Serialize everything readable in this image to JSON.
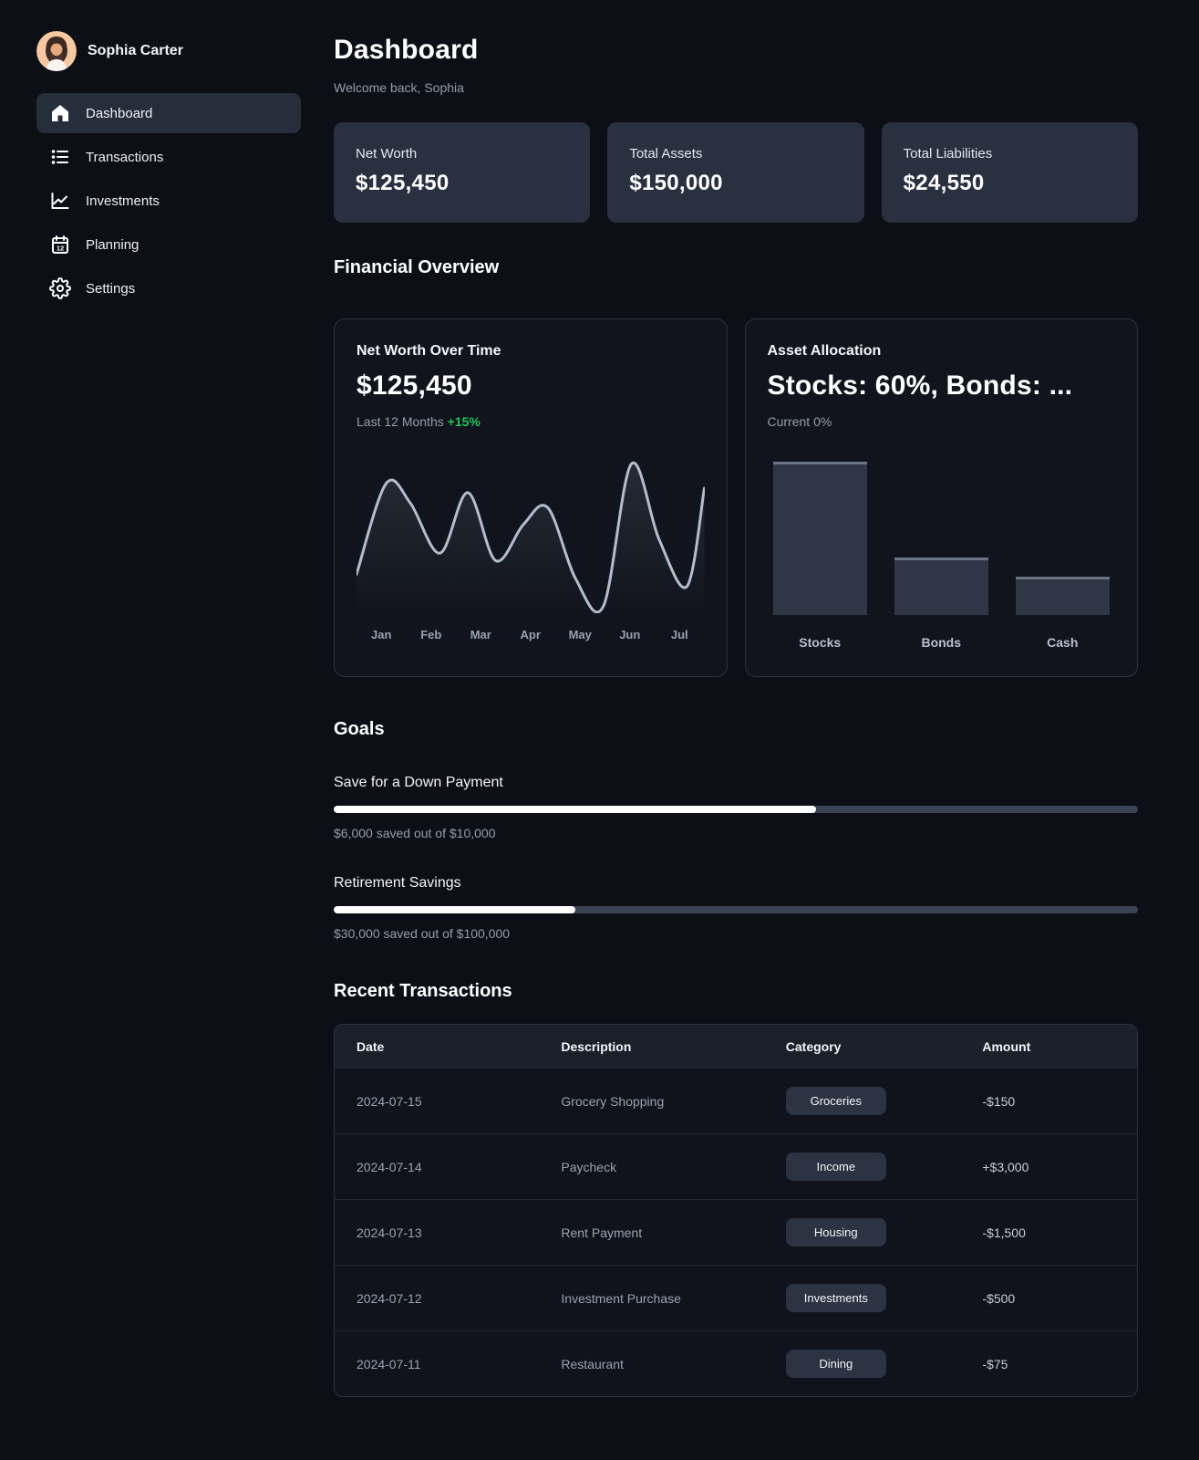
{
  "sidebar": {
    "user_name": "Sophia Carter",
    "nav": [
      {
        "label": "Dashboard",
        "icon": "home-icon",
        "active": true
      },
      {
        "label": "Transactions",
        "icon": "list-icon",
        "active": false
      },
      {
        "label": "Investments",
        "icon": "chart-line-icon",
        "active": false
      },
      {
        "label": "Planning",
        "icon": "calendar-icon",
        "active": false
      },
      {
        "label": "Settings",
        "icon": "gear-icon",
        "active": false
      }
    ]
  },
  "header": {
    "title": "Dashboard",
    "subtitle": "Welcome back, Sophia"
  },
  "stats": [
    {
      "label": "Net Worth",
      "value": "$125,450"
    },
    {
      "label": "Total Assets",
      "value": "$150,000"
    },
    {
      "label": "Total Liabilities",
      "value": "$24,550"
    }
  ],
  "financial_overview": {
    "heading": "Financial Overview",
    "net_worth_card": {
      "title": "Net Worth Over Time",
      "value": "$125,450",
      "period": "Last 12 Months",
      "change": "+15%",
      "change_color": "#22c55e"
    },
    "allocation_card": {
      "title": "Asset Allocation",
      "value": "Stocks: 60%, Bonds: ...",
      "subtitle": "Current 0%"
    }
  },
  "chart_data": [
    {
      "type": "line",
      "title": "Net Worth Over Time",
      "x_labels": [
        "Jan",
        "Feb",
        "Mar",
        "Apr",
        "May",
        "Jun",
        "Jul"
      ],
      "points": [
        [
          0,
          78
        ],
        [
          8.5,
          18
        ],
        [
          15.5,
          31
        ],
        [
          24,
          64
        ],
        [
          32,
          24
        ],
        [
          40,
          69
        ],
        [
          48,
          45
        ],
        [
          55,
          34
        ],
        [
          63,
          81
        ],
        [
          71,
          99
        ],
        [
          79,
          5
        ],
        [
          87,
          55
        ],
        [
          95,
          86
        ],
        [
          100,
          21
        ]
      ],
      "line_color": "#b2becd",
      "fill_color": "rgba(170,185,205,0.10)",
      "grid": false,
      "legend": false
    },
    {
      "type": "bar",
      "title": "Asset Allocation",
      "categories": [
        "Stocks",
        "Bonds",
        "Cash"
      ],
      "values": [
        60,
        25,
        15
      ],
      "bar_heights_pct": [
        100,
        37.5,
        25
      ],
      "bar_color": "#2f3645",
      "bar_top_color": "#6a7283"
    }
  ],
  "goals": {
    "heading": "Goals",
    "items": [
      {
        "name": "Save for a Down Payment",
        "percent": 60,
        "caption": "$6,000 saved out of $10,000"
      },
      {
        "name": "Retirement Savings",
        "percent": 30,
        "caption": "$30,000 saved out of $100,000"
      }
    ]
  },
  "transactions": {
    "heading": "Recent Transactions",
    "columns": [
      "Date",
      "Description",
      "Category",
      "Amount"
    ],
    "rows": [
      {
        "date": "2024-07-15",
        "description": "Grocery Shopping",
        "category": "Groceries",
        "amount": "-$150"
      },
      {
        "date": "2024-07-14",
        "description": "Paycheck",
        "category": "Income",
        "amount": "+$3,000"
      },
      {
        "date": "2024-07-13",
        "description": "Rent Payment",
        "category": "Housing",
        "amount": "-$1,500"
      },
      {
        "date": "2024-07-12",
        "description": "Investment Purchase",
        "category": "Investments",
        "amount": "-$500"
      },
      {
        "date": "2024-07-11",
        "description": "Restaurant",
        "category": "Dining",
        "amount": "-$75"
      }
    ]
  },
  "colors": {
    "page_bg": "#0c0f16",
    "card_bg": "#293040",
    "panel_bg": "#11141c",
    "panel_border": "#2c3340",
    "accent_green": "#22c55e",
    "progress_track": "#3a4254",
    "progress_fill": "#ffffff",
    "badge_bg": "#2c3342",
    "text_secondary": "#959eac"
  }
}
